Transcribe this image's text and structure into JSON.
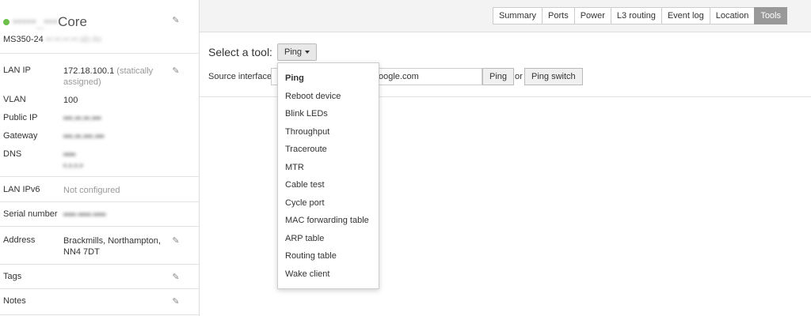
{
  "sidebar": {
    "device_name_hidden": "•••••_•••",
    "device_name_suffix": "Core",
    "model": "MS350-24",
    "mac_hidden": "••:••:••:••:ab:4e",
    "rows": {
      "lan_ip": {
        "label": "LAN IP",
        "value": "172.18.100.1",
        "note": "(statically",
        "note2": "assigned)"
      },
      "vlan": {
        "label": "VLAN",
        "value": "100"
      },
      "public_ip": {
        "label": "Public IP",
        "value": "•••.••.••.•••"
      },
      "gateway": {
        "label": "Gateway",
        "value": "•••.••.•••.•••"
      },
      "dns": {
        "label": "DNS",
        "value1": "••••",
        "value2": "•.•.•.•"
      },
      "lan_ipv6": {
        "label": "LAN IPv6",
        "value": "Not configured"
      },
      "serial": {
        "label": "Serial number",
        "value": "••••-••••-••••"
      },
      "address": {
        "label": "Address",
        "value1": "Brackmills, Northampton,",
        "value2": "NN4 7DT"
      },
      "tags": {
        "label": "Tags"
      },
      "notes": {
        "label": "Notes"
      }
    }
  },
  "tabs": [
    "Summary",
    "Ports",
    "Power",
    "L3 routing",
    "Event log",
    "Location",
    "Tools"
  ],
  "active_tab": "Tools",
  "tools": {
    "select_label": "Select a tool:",
    "selected_tool": "Ping",
    "source_label": "Source interface:",
    "target_value": "oogle.com",
    "ping_button": "Ping",
    "or_text": "or",
    "ping_switch_button": "Ping switch"
  },
  "menu": {
    "items": [
      "Ping",
      "Reboot device",
      "Blink LEDs",
      "Throughput",
      "Traceroute",
      "MTR",
      "Cable test",
      "Cycle port",
      "MAC forwarding table",
      "ARP table",
      "Routing table",
      "Wake client"
    ]
  },
  "colors": {
    "status_green": "#6cc04a",
    "active_tab_bg": "#999999"
  }
}
